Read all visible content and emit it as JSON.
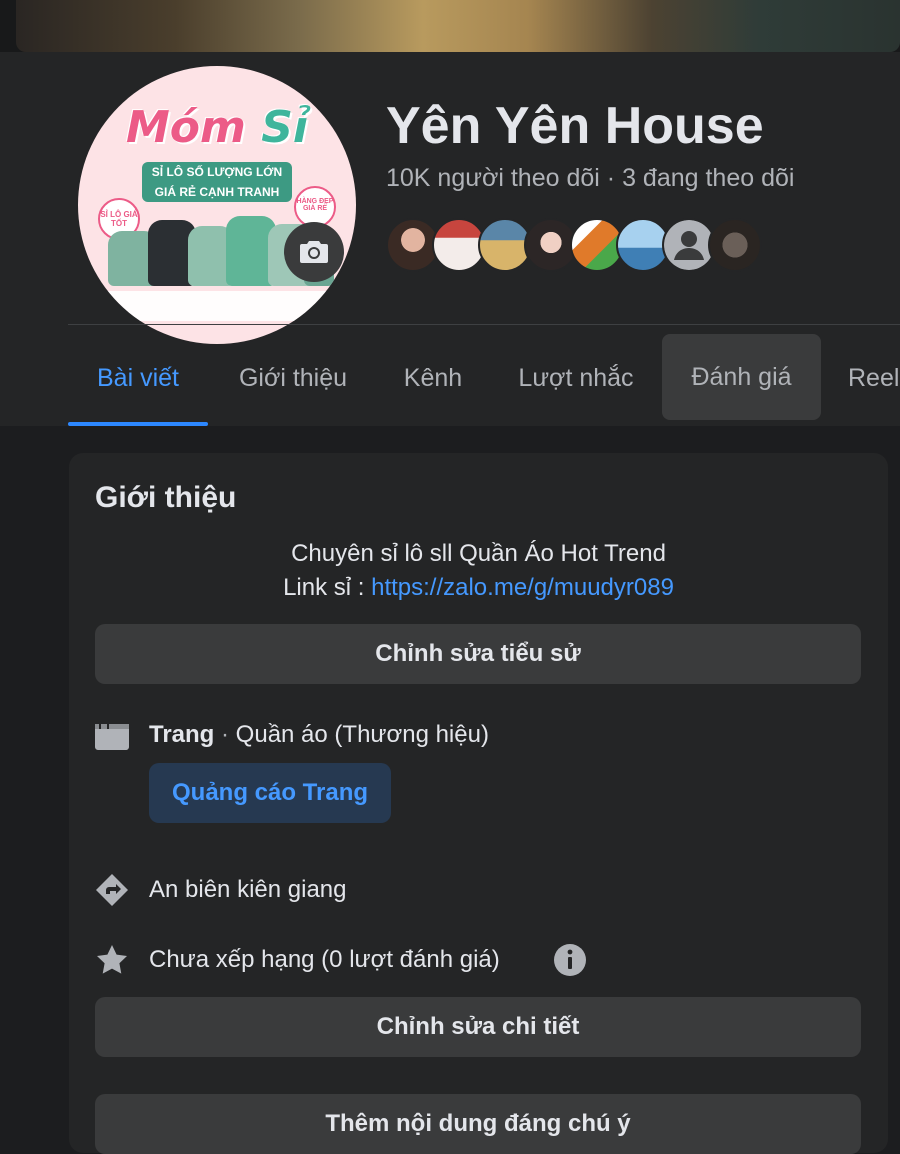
{
  "page": {
    "name": "Yên Yên House",
    "followers": "10K người theo dõi",
    "separator": "·",
    "following": "3 đang theo dõi"
  },
  "avatar": {
    "title_part1": "Móm",
    "title_part2": "Sỉ",
    "ribbon_line1": "SỈ LÔ SỐ LƯỢNG LỚN",
    "ribbon_line2": "GIÁ RẺ CẠNH TRANH",
    "badge_left": "SỈ LÔ GIÁ TỐT",
    "badge_right": "HÀNG ĐẸP GIÁ RẺ"
  },
  "tabs": [
    {
      "label": "Bài viết",
      "active": true
    },
    {
      "label": "Giới thiệu"
    },
    {
      "label": "Kênh"
    },
    {
      "label": "Lượt nhắc"
    },
    {
      "label": "Đánh giá",
      "hover": true
    },
    {
      "label": "Reels"
    }
  ],
  "intro": {
    "title": "Giới thiệu",
    "bio_line1": "Chuyên sỉ lô sll Quần Áo Hot Trend",
    "bio_link_prefix": "Link sỉ : ",
    "bio_link": "https://zalo.me/g/muudyr089",
    "edit_bio_button": "Chỉnh sửa tiểu sử",
    "category_label": "Trang",
    "category_dot": " · ",
    "category_value": "Quần áo (Thương hiệu)",
    "promote_button": "Quảng cáo Trang",
    "location": "An biên kiên giang",
    "rating": "Chưa xếp hạng (0 lượt đánh giá)",
    "edit_details_button": "Chỉnh sửa chi tiết",
    "featured_button": "Thêm nội dung đáng chú ý"
  },
  "colors": {
    "accent": "#2d88ff",
    "link": "#4599ff",
    "background": "#1c1d1f",
    "surface": "#242526",
    "button": "#3a3b3c"
  },
  "icons": [
    "camera-icon",
    "page-flag-icon",
    "directions-icon",
    "star-icon",
    "info-icon"
  ]
}
